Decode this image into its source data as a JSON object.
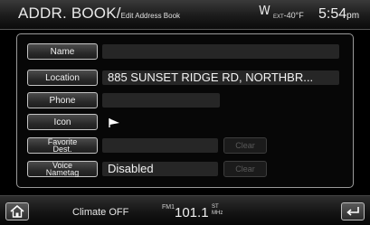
{
  "header": {
    "title": "ADDR. BOOK/",
    "subtitle": "Edit Address Book",
    "compass": "W",
    "ext_label": "EXT",
    "ext_temp": "-40°F",
    "clock": "5:54",
    "clock_suffix": "pm"
  },
  "fields": [
    {
      "label": "Name",
      "value": ""
    },
    {
      "label": "Location",
      "value": "885 SUNSET RIDGE RD, NORTHBR..."
    },
    {
      "label": "Phone",
      "value": ""
    },
    {
      "label": "Icon",
      "value": "",
      "icon": "flag-icon"
    },
    {
      "label_line1": "Favorite",
      "label_line2": "Dest.",
      "value": "",
      "clear_label": "Clear"
    },
    {
      "label_line1": "Voice",
      "label_line2": "Nametag",
      "value": "Disabled",
      "clear_label": "Clear"
    }
  ],
  "footer": {
    "home_icon": "home-icon",
    "climate": "Climate OFF",
    "band": "FM1",
    "frequency": "101.1",
    "stereo_top": "ST",
    "stereo_bottom": "MHz",
    "back_icon": "back-icon"
  },
  "colors": {
    "background": "#000000",
    "panel_border": "#9a9a9a",
    "value_bar": "#262626",
    "disabled_text": "#5a5a5a"
  }
}
